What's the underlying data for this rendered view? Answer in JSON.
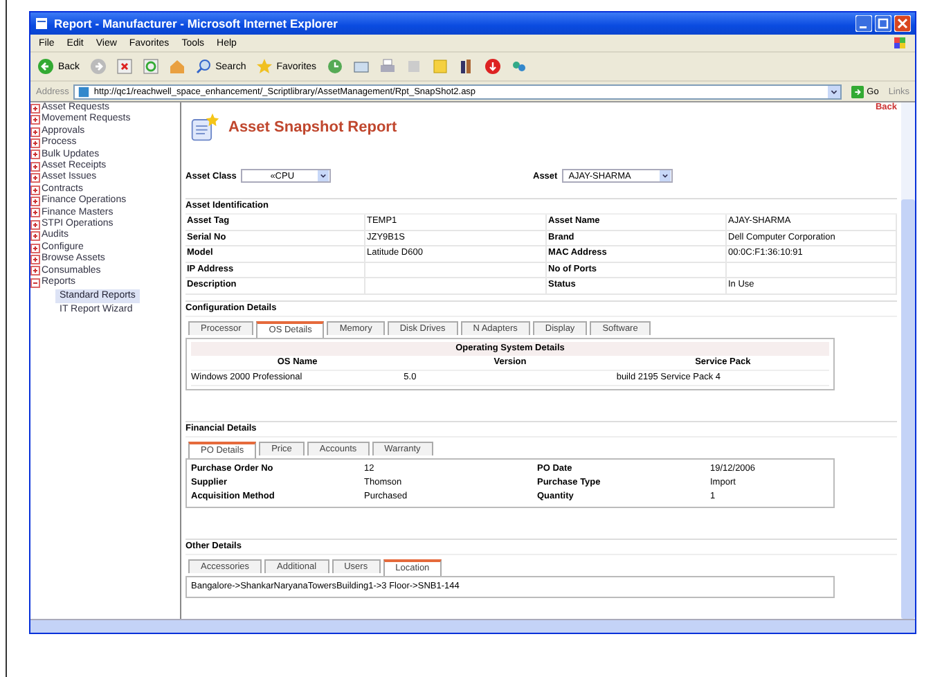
{
  "window": {
    "title": "Report - Manufacturer - Microsoft Internet Explorer"
  },
  "menu": [
    "File",
    "Edit",
    "View",
    "Favorites",
    "Tools",
    "Help"
  ],
  "toolbar": {
    "back": "Back",
    "search": "Search",
    "favorites": "Favorites"
  },
  "address_bar": {
    "label": "Address",
    "url": "http://qc1/reachwell_space_enhancement/_Scriptlibrary/AssetManagement/Rpt_SnapShot2.asp",
    "go": "Go",
    "links": "Links"
  },
  "sidebar": {
    "items": [
      {
        "label": "Asset Requests",
        "expanded": false
      },
      {
        "label": "Movement Requests",
        "expanded": false
      },
      {
        "label": "Approvals",
        "expanded": false
      },
      {
        "label": "Process",
        "expanded": false
      },
      {
        "label": "Bulk Updates",
        "expanded": false
      },
      {
        "label": "Asset Receipts",
        "expanded": false
      },
      {
        "label": "Asset Issues",
        "expanded": false
      },
      {
        "label": "Contracts",
        "expanded": false
      },
      {
        "label": "Finance Operations",
        "expanded": false
      },
      {
        "label": "Finance Masters",
        "expanded": false
      },
      {
        "label": "STPI Operations",
        "expanded": false
      },
      {
        "label": "Audits",
        "expanded": false
      },
      {
        "label": "Configure",
        "expanded": false
      },
      {
        "label": "Browse Assets",
        "expanded": false
      },
      {
        "label": "Consumables",
        "expanded": false
      },
      {
        "label": "Reports",
        "expanded": true,
        "children": [
          {
            "label": "Standard Reports",
            "selected": true
          },
          {
            "label": "IT Report Wizard",
            "selected": false
          }
        ]
      }
    ]
  },
  "back_link": "Back",
  "report_title": "Asset Snapshot Report",
  "filters": [
    {
      "label": "Asset Class",
      "value": "«CPU"
    },
    {
      "label": "Asset",
      "value": "AJAY-SHARMA"
    }
  ],
  "asset_identification": {
    "heading": "Asset Identification",
    "rows": [
      [
        "Asset Tag",
        "TEMP1",
        "Asset Name",
        "AJAY-SHARMA"
      ],
      [
        "Serial No",
        "JZY9B1S",
        "Brand",
        "Dell Computer Corporation"
      ],
      [
        "Model",
        "Latitude D600",
        "MAC Address",
        "00:0C:F1:36:10:91"
      ],
      [
        "IP Address",
        null,
        "No of Ports",
        null
      ],
      [
        "Description",
        null,
        "Status",
        "In Use"
      ]
    ]
  },
  "configuration": {
    "heading": "Configuration Details",
    "tabs": [
      {
        "label": "Processor",
        "selected": false
      },
      {
        "label": "OS Details",
        "selected": true
      },
      {
        "label": "Memory",
        "selected": false
      },
      {
        "label": "Disk Drives",
        "selected": false
      },
      {
        "label": "N Adapters",
        "selected": false
      },
      {
        "label": "Display",
        "selected": false
      },
      {
        "label": "Software",
        "selected": false
      }
    ],
    "table_title": "Operating System Details",
    "columns": [
      "OS Name",
      "Version",
      "Service Pack"
    ],
    "rows": [
      [
        "Windows 2000 Professional",
        "5.0",
        "build 2195 Service Pack 4"
      ]
    ]
  },
  "financial": {
    "heading": "Financial Details",
    "tabs": [
      {
        "label": "PO Details",
        "selected": true
      },
      {
        "label": "Price",
        "selected": false
      },
      {
        "label": "Accounts",
        "selected": false
      },
      {
        "label": "Warranty",
        "selected": false
      }
    ],
    "rows": [
      [
        "Purchase Order No",
        "12",
        "PO Date",
        "19/12/2006"
      ],
      [
        "Supplier",
        "Thomson",
        "Purchase Type",
        "Import"
      ],
      [
        "Acquisition Method",
        "Purchased",
        "Quantity",
        "1"
      ]
    ]
  },
  "other": {
    "heading": "Other Details",
    "tabs": [
      {
        "label": "Accessories",
        "selected": false
      },
      {
        "label": "Additional",
        "selected": false
      },
      {
        "label": "Users",
        "selected": false
      },
      {
        "label": "Location",
        "selected": true
      }
    ],
    "location": "Bangalore->ShankarNaryanaTowersBuilding1->3 Floor->SNB1-144"
  }
}
